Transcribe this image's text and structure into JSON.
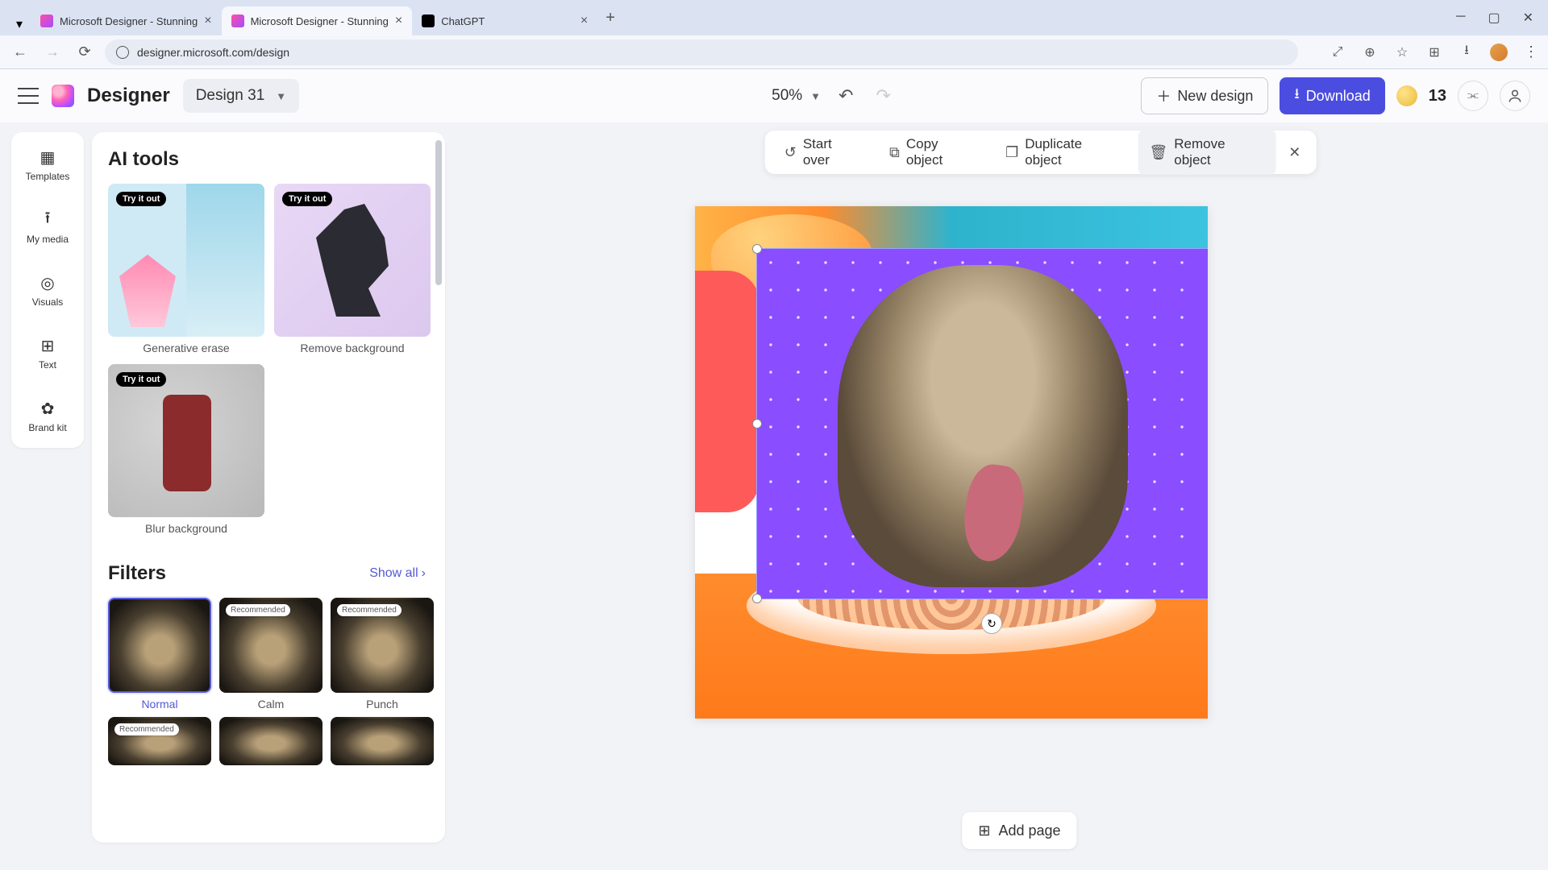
{
  "browser": {
    "tabs": [
      {
        "title": "Microsoft Designer - Stunning",
        "active": false
      },
      {
        "title": "Microsoft Designer - Stunning",
        "active": true
      },
      {
        "title": "ChatGPT",
        "active": false
      }
    ],
    "url": "designer.microsoft.com/design"
  },
  "header": {
    "logo_text": "Designer",
    "design_name": "Design 31",
    "zoom": "50%",
    "new_design": "New design",
    "download": "Download",
    "credits": "13"
  },
  "rail": {
    "items": [
      "Templates",
      "My media",
      "Visuals",
      "Text",
      "Brand kit"
    ]
  },
  "panel": {
    "ai_heading": "AI tools",
    "try_badge": "Try it out",
    "ai_tools": [
      {
        "label": "Generative erase"
      },
      {
        "label": "Remove background"
      },
      {
        "label": "Blur background"
      }
    ],
    "filters_heading": "Filters",
    "show_all": "Show all",
    "rec_badge": "Recommended",
    "filters": [
      {
        "label": "Normal",
        "selected": true,
        "recommended": false
      },
      {
        "label": "Calm",
        "selected": false,
        "recommended": true
      },
      {
        "label": "Punch",
        "selected": false,
        "recommended": true
      }
    ],
    "filters_row2": [
      {
        "recommended": true
      },
      {
        "recommended": false
      },
      {
        "recommended": false
      }
    ]
  },
  "context_bar": {
    "start_over": "Start over",
    "copy": "Copy object",
    "duplicate": "Duplicate object",
    "remove": "Remove object"
  },
  "footer": {
    "add_page": "Add page"
  }
}
